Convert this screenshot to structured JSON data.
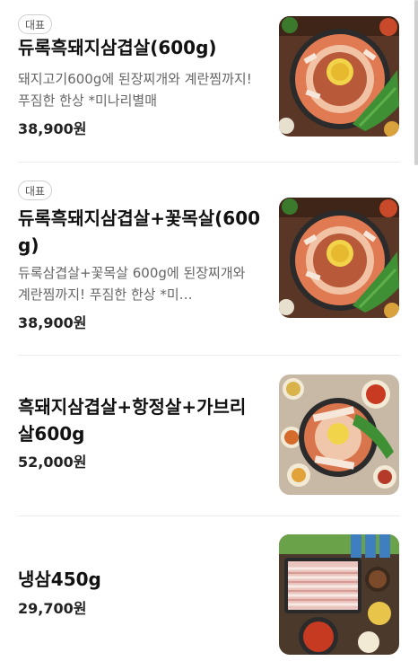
{
  "menu": {
    "items": [
      {
        "badge": "대표",
        "name": "듀록흑돼지삼겹살(600g)",
        "description": "돼지고기600g에 된장찌개와 계란찜까지! 푸짐한 한상 *미나리별매",
        "price": "38,900원",
        "image_icon": "grilled-pork-platter-image"
      },
      {
        "badge": "대표",
        "name": "듀록흑돼지삼겹살+꽃목살(600g)",
        "description": "듀록삼겹살+꽃목살 600g에 된장찌개와 계란찜까지! 푸짐한 한상 *미…",
        "price": "38,900원",
        "image_icon": "grilled-pork-platter-image"
      },
      {
        "name": "흑돼지삼겹살+항정살+가브리살600g",
        "price": "52,000원",
        "image_icon": "pork-combo-platter-image"
      },
      {
        "name": "냉삼450g",
        "price": "29,700원",
        "image_icon": "frozen-pork-belly-image"
      }
    ]
  }
}
